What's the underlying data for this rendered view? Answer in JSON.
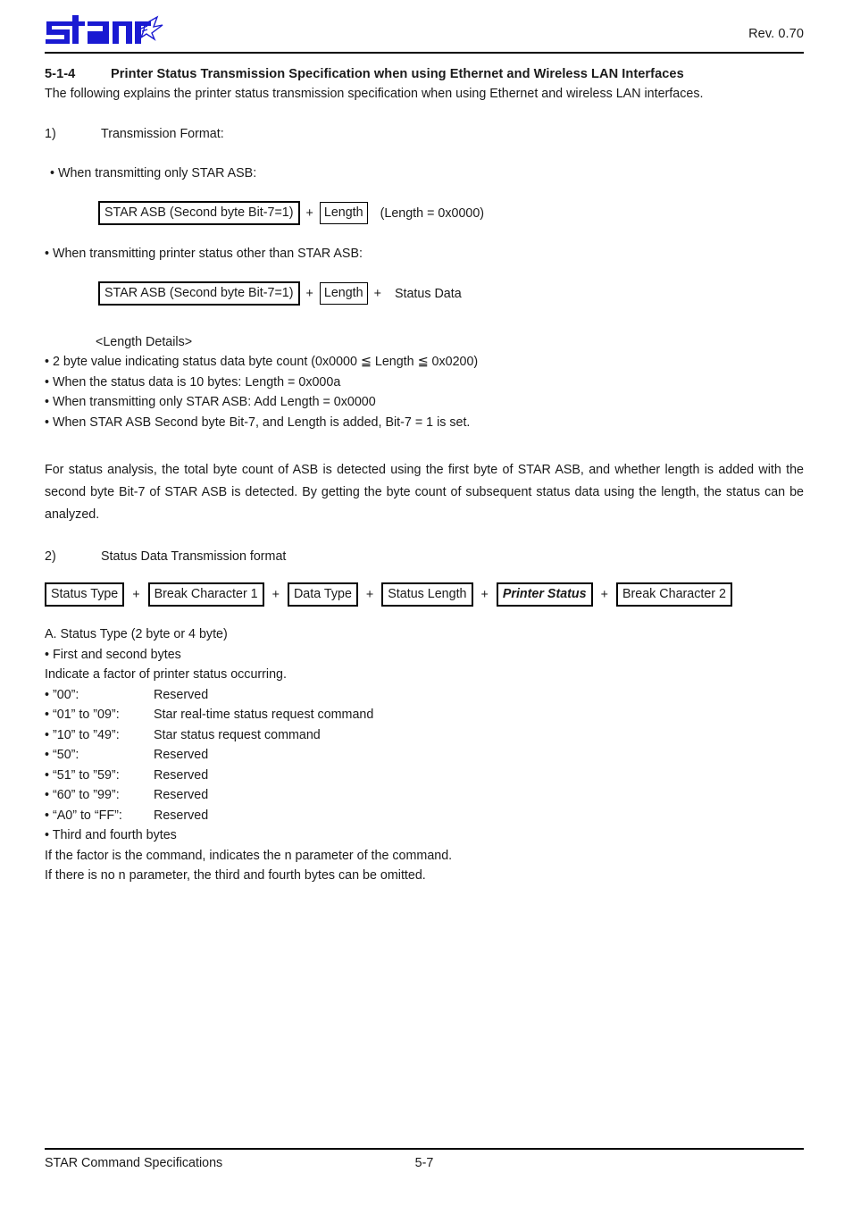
{
  "header": {
    "logo_text": "star",
    "logo_color": "#1a1ad2",
    "revision": "Rev. 0.70"
  },
  "heading": {
    "number": "5-1-4",
    "title": "Printer Status Transmission Specification when using Ethernet and Wireless LAN Interfaces"
  },
  "intro": "The following explains the printer status transmission specification when using Ethernet and wireless LAN interfaces.",
  "item1": {
    "marker": "1)",
    "label": "Transmission Format:",
    "case_a_label": "• When transmitting only STAR ASB:",
    "case_a_diagram": {
      "box1": "STAR ASB (Second byte Bit-7=1)",
      "plus1": "+",
      "box2": "Length",
      "note": "(Length = 0x0000)"
    },
    "case_b_label": "• When transmitting printer status other than STAR ASB:",
    "case_b_diagram": {
      "box1": "STAR ASB (Second byte Bit-7=1)",
      "plus1": "+",
      "box2": "Length",
      "plus2": "+",
      "tail": "Status Data"
    },
    "length_details": {
      "title": "<Length Details>",
      "items": [
        "• 2 byte value indicating status data byte count (0x0000 ≦ Length ≦ 0x0200)",
        "• When the status data is 10 bytes: Length = 0x000a",
        "• When transmitting only STAR ASB: Add Length = 0x0000",
        "• When STAR ASB Second byte Bit-7, and Length is added, Bit-7 = 1 is set."
      ]
    },
    "analysis": "For status analysis, the total byte count of ASB is detected using the first byte of STAR ASB, and whether length is added with the second byte Bit-7 of STAR ASB is detected. By getting the byte count of subsequent status data using the length, the status can be analyzed."
  },
  "item2": {
    "marker": "2)",
    "label": "Status Data  Transmission format",
    "diagram": {
      "boxes": [
        "Status Type",
        "Break Character 1",
        "Data Type",
        "Status Length",
        "Printer Status",
        "Break Character 2"
      ],
      "separator": "+",
      "emphasized_index": 4
    },
    "status_type": {
      "title": "A. Status Type (2 byte or 4 byte)",
      "first_second_label": "• First and second bytes",
      "first_second_desc": "Indicate a factor of printer status occurring.",
      "rows": [
        {
          "code": "• ”00”:",
          "desc": "Reserved"
        },
        {
          "code": "• “01” to ”09”:",
          "desc": "Star real-time status request command"
        },
        {
          "code": "• ”10” to ”49”:",
          "desc": "Star status request command"
        },
        {
          "code": "• “50”:",
          "desc": "Reserved"
        },
        {
          "code": "• “51” to ”59”:",
          "desc": "Reserved"
        },
        {
          "code": "• “60” to ”99”:",
          "desc": "Reserved"
        },
        {
          "code": "• “A0” to “FF”:",
          "desc": "Reserved"
        }
      ],
      "third_fourth_label": "• Third and fourth bytes",
      "third_fourth_desc1": "If the factor is the command, indicates the n parameter of the command.",
      "third_fourth_desc2": "If there is no n parameter, the third and fourth bytes can be omitted."
    }
  },
  "footer": {
    "left": "STAR Command Specifications",
    "page": "5-7"
  }
}
